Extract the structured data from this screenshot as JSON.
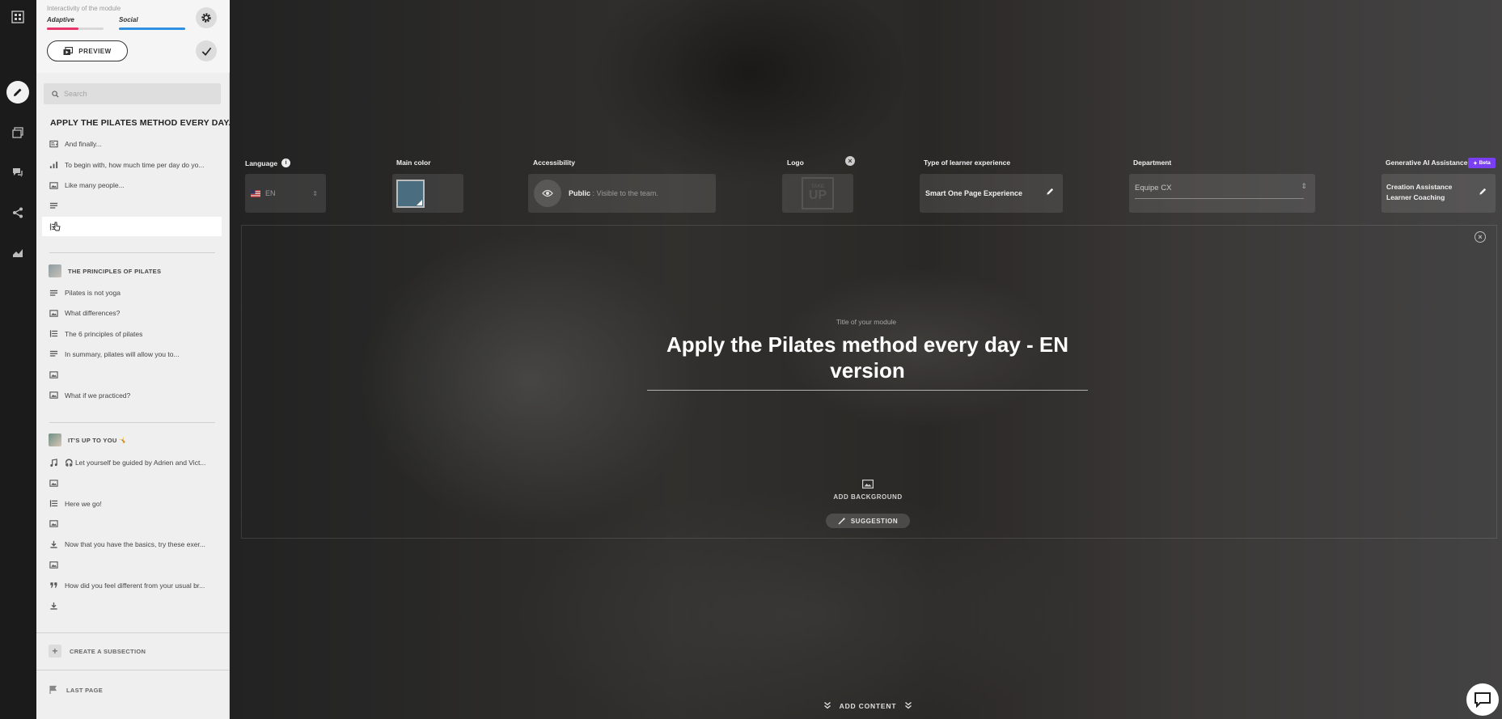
{
  "interactivity": {
    "title": "Interactivity of the module",
    "adaptive_label": "Adaptive",
    "social_label": "Social",
    "adaptive_level": 0.55,
    "social_level": 1.0,
    "adaptive_color": "#e8336b",
    "social_color": "#2f8fe0"
  },
  "toolbar": {
    "preview_label": "PREVIEW"
  },
  "search": {
    "placeholder": "Search"
  },
  "module": {
    "title": "APPLY THE PILATES METHOD EVERY DAY...",
    "items": [
      {
        "label": "And finally...",
        "icon": "text-image-icon"
      },
      {
        "label": "To begin with, how much time per day do yo...",
        "icon": "poll-icon"
      },
      {
        "label": "Like many people...",
        "icon": "image-icon"
      },
      {
        "label": "",
        "icon": "text-icon"
      },
      {
        "label": "",
        "icon": "list-icon"
      }
    ]
  },
  "sections": [
    {
      "title": "THE PRINCIPLES OF PILATES",
      "items": [
        {
          "label": "Pilates is not yoga",
          "icon": "text-icon"
        },
        {
          "label": "What differences?",
          "icon": "image-icon"
        },
        {
          "label": "The 6 principles of pilates",
          "icon": "list-icon"
        },
        {
          "label": "In summary, pilates will allow you to...",
          "icon": "text-icon"
        },
        {
          "label": "",
          "icon": "image-icon"
        },
        {
          "label": "What if we practiced?",
          "icon": "image-icon"
        }
      ]
    },
    {
      "title": "IT'S UP TO YOU 🤸",
      "items": [
        {
          "label": "🎧 Let yourself be guided by Adrien and Vict...",
          "icon": "music-icon"
        },
        {
          "label": "",
          "icon": "image-icon"
        },
        {
          "label": "Here we go!",
          "icon": "list-icon"
        },
        {
          "label": "",
          "icon": "image-icon"
        },
        {
          "label": "Now that you have the basics, try these exer...",
          "icon": "download-icon"
        },
        {
          "label": "",
          "icon": "image-icon"
        },
        {
          "label": "How did you feel different from your usual br...",
          "icon": "quote-icon"
        },
        {
          "label": "",
          "icon": "download-icon"
        }
      ]
    }
  ],
  "sidebar_footer": {
    "create_subsection": "CREATE A SUBSECTION",
    "last_page": "LAST PAGE"
  },
  "settings": {
    "language_label": "Language",
    "language_value": "EN",
    "main_color_label": "Main color",
    "main_color": "#4a6d80",
    "accessibility_label": "Accessibility",
    "accessibility_value": "Public",
    "accessibility_desc": ": Visible to the team.",
    "logo_label": "Logo",
    "logo_text_top": "TAKE",
    "logo_text_bottom": "UP",
    "experience_label": "Type of learner experience",
    "experience_value": "Smart One Page Experience",
    "department_label": "Department",
    "department_value": "Equipe CX",
    "ai_label": "Generative AI Assistance",
    "ai_badge": "Beta",
    "ai_line1": "Creation Assistance",
    "ai_line2": "Learner Coaching"
  },
  "hero": {
    "caption": "Title of your module",
    "title": "Apply the Pilates method every day - EN version",
    "add_background": "ADD BACKGROUND",
    "suggestion": "SUGGESTION"
  },
  "footer": {
    "add_content": "ADD CONTENT"
  }
}
